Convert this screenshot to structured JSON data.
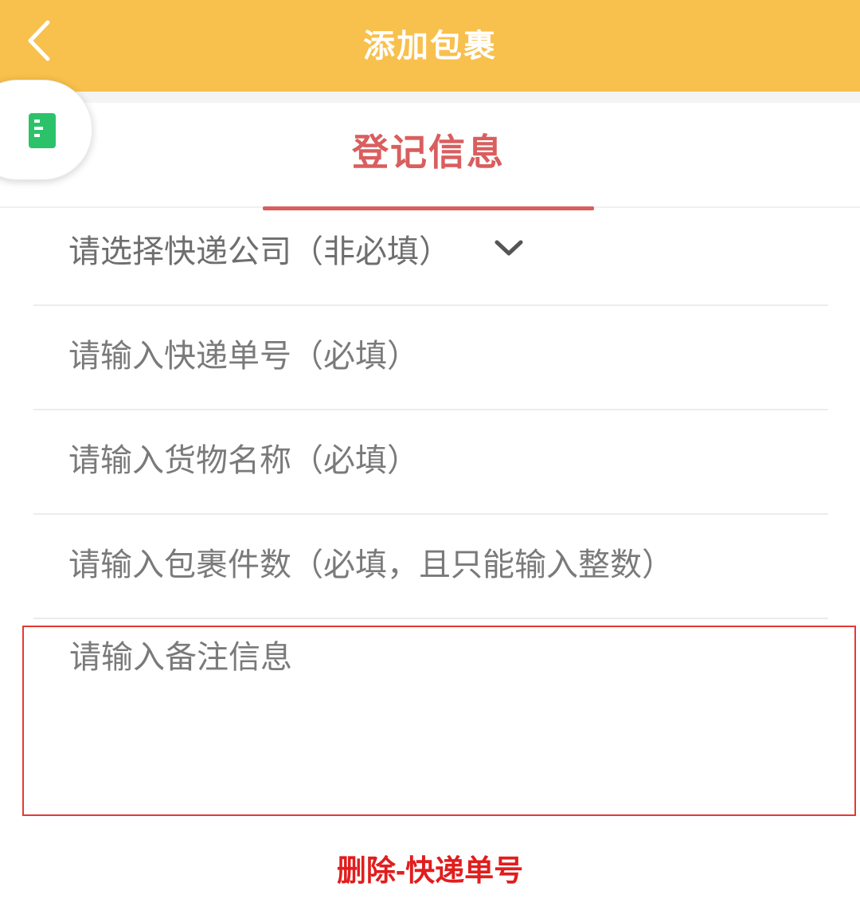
{
  "header": {
    "title": "添加包裹",
    "background_color": "#f8c04c",
    "back_icon": "chevron-left-icon"
  },
  "tabs": [
    {
      "label": "登记信息",
      "active": true,
      "color": "#d95e5e"
    }
  ],
  "float_button": {
    "icon": "document-icon",
    "icon_color": "#2cc26a"
  },
  "form": {
    "company_select": {
      "placeholder": "请选择快递公司（非必填）",
      "icon": "chevron-down-icon"
    },
    "tracking_number": {
      "placeholder": "请输入快递单号（必填）",
      "value": ""
    },
    "goods_name": {
      "placeholder": "请输入货物名称（必填）",
      "value": ""
    },
    "package_count": {
      "placeholder": "请输入包裹件数（必填，且只能输入整数）",
      "value": ""
    },
    "remark": {
      "placeholder": "请输入备注信息",
      "value": ""
    }
  },
  "annotation": {
    "text": "删除-快递单号",
    "color": "#e11d1d"
  }
}
